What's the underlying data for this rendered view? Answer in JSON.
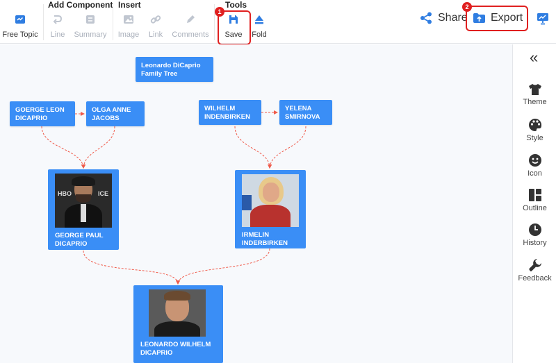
{
  "toolbar": {
    "free_topic": "Free Topic",
    "groups": {
      "add_component": "Add Component",
      "insert": "Insert",
      "tools": "Tools"
    },
    "line": "Line",
    "summary": "Summary",
    "image": "Image",
    "link": "Link",
    "comments": "Comments",
    "save": "Save",
    "fold": "Fold",
    "share": "Share",
    "export": "Export"
  },
  "steps": {
    "one": "1",
    "two": "2"
  },
  "tree": {
    "title": "Leonardo DiCaprio Family Tree",
    "george_leon": "GOERGE LEON DICAPRIO",
    "olga": "OLGA ANNE JACOBS",
    "wilhelm": "WILHELM INDENBIRKEN",
    "yelena": "YELENA SMIRNOVA",
    "george_paul": "GEORGE PAUL DICAPRIO",
    "irmelin": "IRMELIN INDERBIRKEN",
    "leonardo": "LEONARDO WILHELM DICAPRIO"
  },
  "sidebar": {
    "collapse": "«",
    "theme": "Theme",
    "style": "Style",
    "icon": "Icon",
    "outline": "Outline",
    "history": "History",
    "feedback": "Feedback"
  },
  "colors": {
    "node_blue": "#3a8ef6",
    "highlight_red": "#e02020",
    "connector_red": "#f05a4a",
    "icon_blue": "#2f7de1",
    "disabled_gray": "#c0c6d0"
  }
}
